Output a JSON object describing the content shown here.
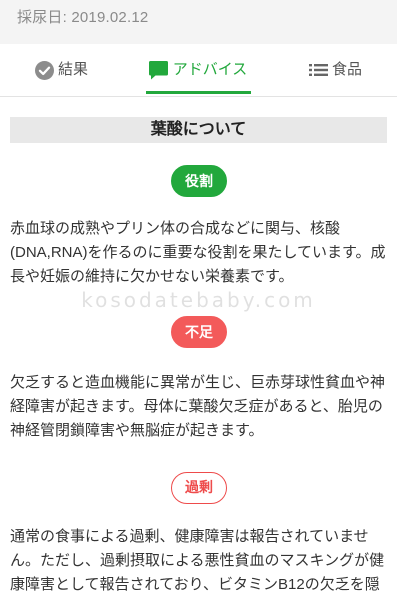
{
  "header": {
    "sample_date_label": "採尿日: 2019.02.12"
  },
  "tabs": [
    {
      "label": "結果",
      "icon": "check-circle-icon",
      "active": false
    },
    {
      "label": "アドバイス",
      "icon": "chat-bubble-icon",
      "active": true
    },
    {
      "label": "食品",
      "icon": "list-icon",
      "active": false
    }
  ],
  "theme": {
    "accent": "#22a83c",
    "tab_inactive": "#555555",
    "header_bg": "#f4f4f4",
    "header_text": "#8a8a8a",
    "title_bg": "#e8e8e8"
  },
  "article": {
    "title": "葉酸について",
    "sections": [
      {
        "badge": "役割",
        "badge_bg": "#22a83c",
        "badge_fg": "#ffffff",
        "badge_border": "#22a83c",
        "text": "赤血球の成熟やプリン体の合成などに関与、核酸(DNA,RNA)を作るのに重要な役割を果たしています。成長や妊娠の維持に欠かせない栄養素です。"
      },
      {
        "badge": "不足",
        "badge_bg": "#f35a5a",
        "badge_fg": "#ffffff",
        "badge_border": "#f35a5a",
        "text": "欠乏すると造血機能に異常が生じ、巨赤芽球性貧血や神経障害が起きます。母体に葉酸欠乏症があると、胎児の神経管閉鎖障害や無脳症が起きます。"
      },
      {
        "badge": "過剰",
        "badge_bg": "#ffffff",
        "badge_fg": "#ee4b4b",
        "badge_border": "#ee4b4b",
        "text": "通常の食事による過剰、健康障害は報告されていません。ただし、過剰摂取による悪性貧血のマスキングが健康障害として報告されており、ビタミンB12の欠乏を隠"
      }
    ]
  },
  "watermark": "kosodatebaby.com"
}
